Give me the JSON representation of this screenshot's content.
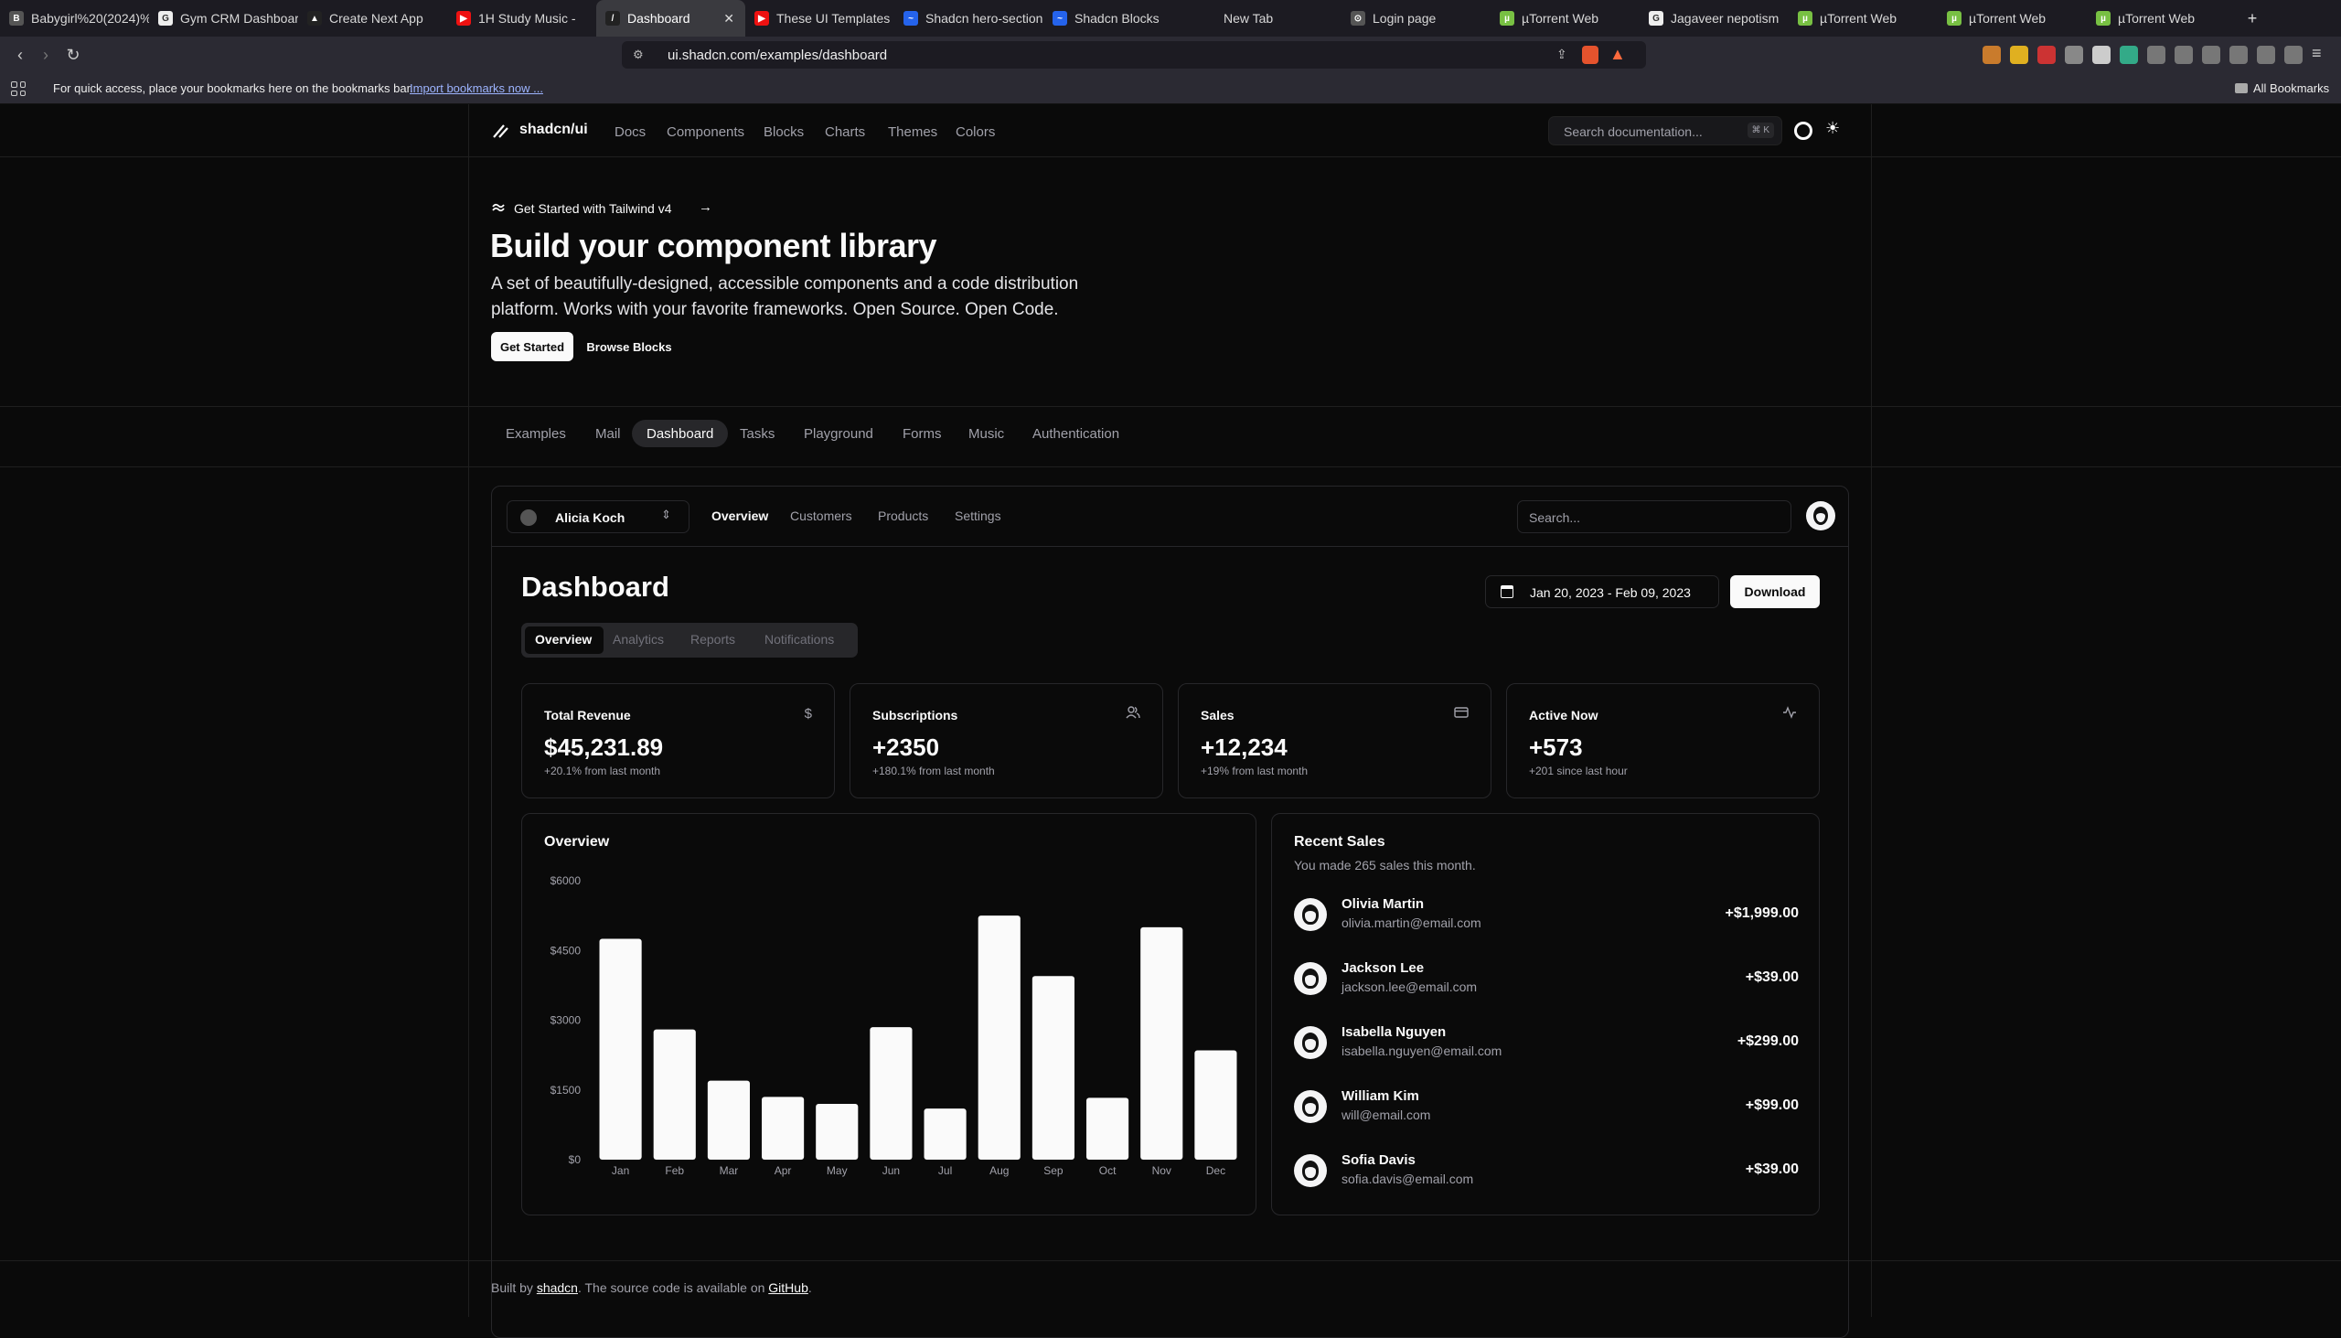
{
  "browser": {
    "tabs": [
      {
        "title": "Babygirl%20(2024)%",
        "fav": "B",
        "fav_color": "#555"
      },
      {
        "title": "Gym CRM Dashboard",
        "fav": "G",
        "fav_color": "#eee"
      },
      {
        "title": "Create Next App",
        "fav": "▲",
        "fav_color": "#222"
      },
      {
        "title": "1H Study Music -",
        "fav": "▶",
        "fav_color": "#e11"
      },
      {
        "title": "Dashboard",
        "fav": "/",
        "fav_color": "#222"
      },
      {
        "title": "These UI Templates",
        "fav": "▶",
        "fav_color": "#e11"
      },
      {
        "title": "Shadcn hero-section",
        "fav": "~",
        "fav_color": "#2563eb"
      },
      {
        "title": "Shadcn Blocks",
        "fav": "~",
        "fav_color": "#2563eb"
      },
      {
        "title": "New Tab",
        "fav": "",
        "fav_color": "transparent"
      },
      {
        "title": "Login page",
        "fav": "⊙",
        "fav_color": "#555"
      },
      {
        "title": "µTorrent Web",
        "fav": "µ",
        "fav_color": "#78c043"
      },
      {
        "title": "Jagaveer nepotism",
        "fav": "G",
        "fav_color": "#eee"
      },
      {
        "title": "µTorrent Web",
        "fav": "µ",
        "fav_color": "#78c043"
      },
      {
        "title": "µTorrent Web",
        "fav": "µ",
        "fav_color": "#78c043"
      },
      {
        "title": "µTorrent Web",
        "fav": "µ",
        "fav_color": "#78c043"
      }
    ],
    "new_tab_label": "+",
    "url": "ui.shadcn.com/examples/dashboard",
    "bookmark_bar_text": "For quick access, place your bookmarks here on the bookmarks bar.",
    "import_link": "Import bookmarks now ...",
    "all_bookmarks": "All Bookmarks"
  },
  "site": {
    "logo": "shadcn/ui",
    "nav": [
      "Docs",
      "Components",
      "Blocks",
      "Charts",
      "Themes",
      "Colors"
    ],
    "search_placeholder": "Search documentation...",
    "search_shortcut": "⌘ K"
  },
  "hero": {
    "announcement": "Get Started with Tailwind v4",
    "title": "Build your component library",
    "desc_line1": "A set of beautifully-designed, accessible components and a code distribution",
    "desc_line2": "platform. Works with your favorite frameworks. Open Source. Open Code.",
    "primary_button": "Get Started",
    "secondary_button": "Browse Blocks"
  },
  "examples_tabs": [
    "Examples",
    "Mail",
    "Dashboard",
    "Tasks",
    "Playground",
    "Forms",
    "Music",
    "Authentication"
  ],
  "examples_active": "Dashboard",
  "dashboard": {
    "team": "Alicia Koch",
    "nav": [
      "Overview",
      "Customers",
      "Products",
      "Settings"
    ],
    "search_placeholder": "Search...",
    "title": "Dashboard",
    "date_range": "Jan 20, 2023 - Feb 09, 2023",
    "download": "Download",
    "tabs": [
      "Overview",
      "Analytics",
      "Reports",
      "Notifications"
    ],
    "stats": [
      {
        "title": "Total Revenue",
        "value": "$45,231.89",
        "sub": "+20.1% from last month",
        "icon": "$"
      },
      {
        "title": "Subscriptions",
        "value": "+2350",
        "sub": "+180.1% from last month",
        "icon": "users-icon"
      },
      {
        "title": "Sales",
        "value": "+12,234",
        "sub": "+19% from last month",
        "icon": "credit-card-icon"
      },
      {
        "title": "Active Now",
        "value": "+573",
        "sub": "+201 since last hour",
        "icon": "activity-icon"
      }
    ],
    "overview_title": "Overview",
    "recent_sales_title": "Recent Sales",
    "recent_sales_sub": "You made 265 sales this month.",
    "recent_sales": [
      {
        "name": "Olivia Martin",
        "email": "olivia.martin@email.com",
        "amount": "+$1,999.00"
      },
      {
        "name": "Jackson Lee",
        "email": "jackson.lee@email.com",
        "amount": "+$39.00"
      },
      {
        "name": "Isabella Nguyen",
        "email": "isabella.nguyen@email.com",
        "amount": "+$299.00"
      },
      {
        "name": "William Kim",
        "email": "will@email.com",
        "amount": "+$99.00"
      },
      {
        "name": "Sofia Davis",
        "email": "sofia.davis@email.com",
        "amount": "+$39.00"
      }
    ]
  },
  "chart_data": {
    "type": "bar",
    "title": "Overview",
    "categories": [
      "Jan",
      "Feb",
      "Mar",
      "Apr",
      "May",
      "Jun",
      "Jul",
      "Aug",
      "Sep",
      "Oct",
      "Nov",
      "Dec"
    ],
    "values": [
      4750,
      2800,
      1700,
      1350,
      1200,
      2850,
      1100,
      5250,
      3950,
      1330,
      5000,
      2350
    ],
    "yticks": [
      "$0",
      "$1500",
      "$3000",
      "$4500",
      "$6000"
    ],
    "ylim": [
      0,
      6000
    ],
    "bar_color": "#fafafa"
  },
  "footer": {
    "pre": "Built by ",
    "author": "shadcn",
    "mid": ". The source code is available on ",
    "repo": "GitHub",
    "post": "."
  }
}
